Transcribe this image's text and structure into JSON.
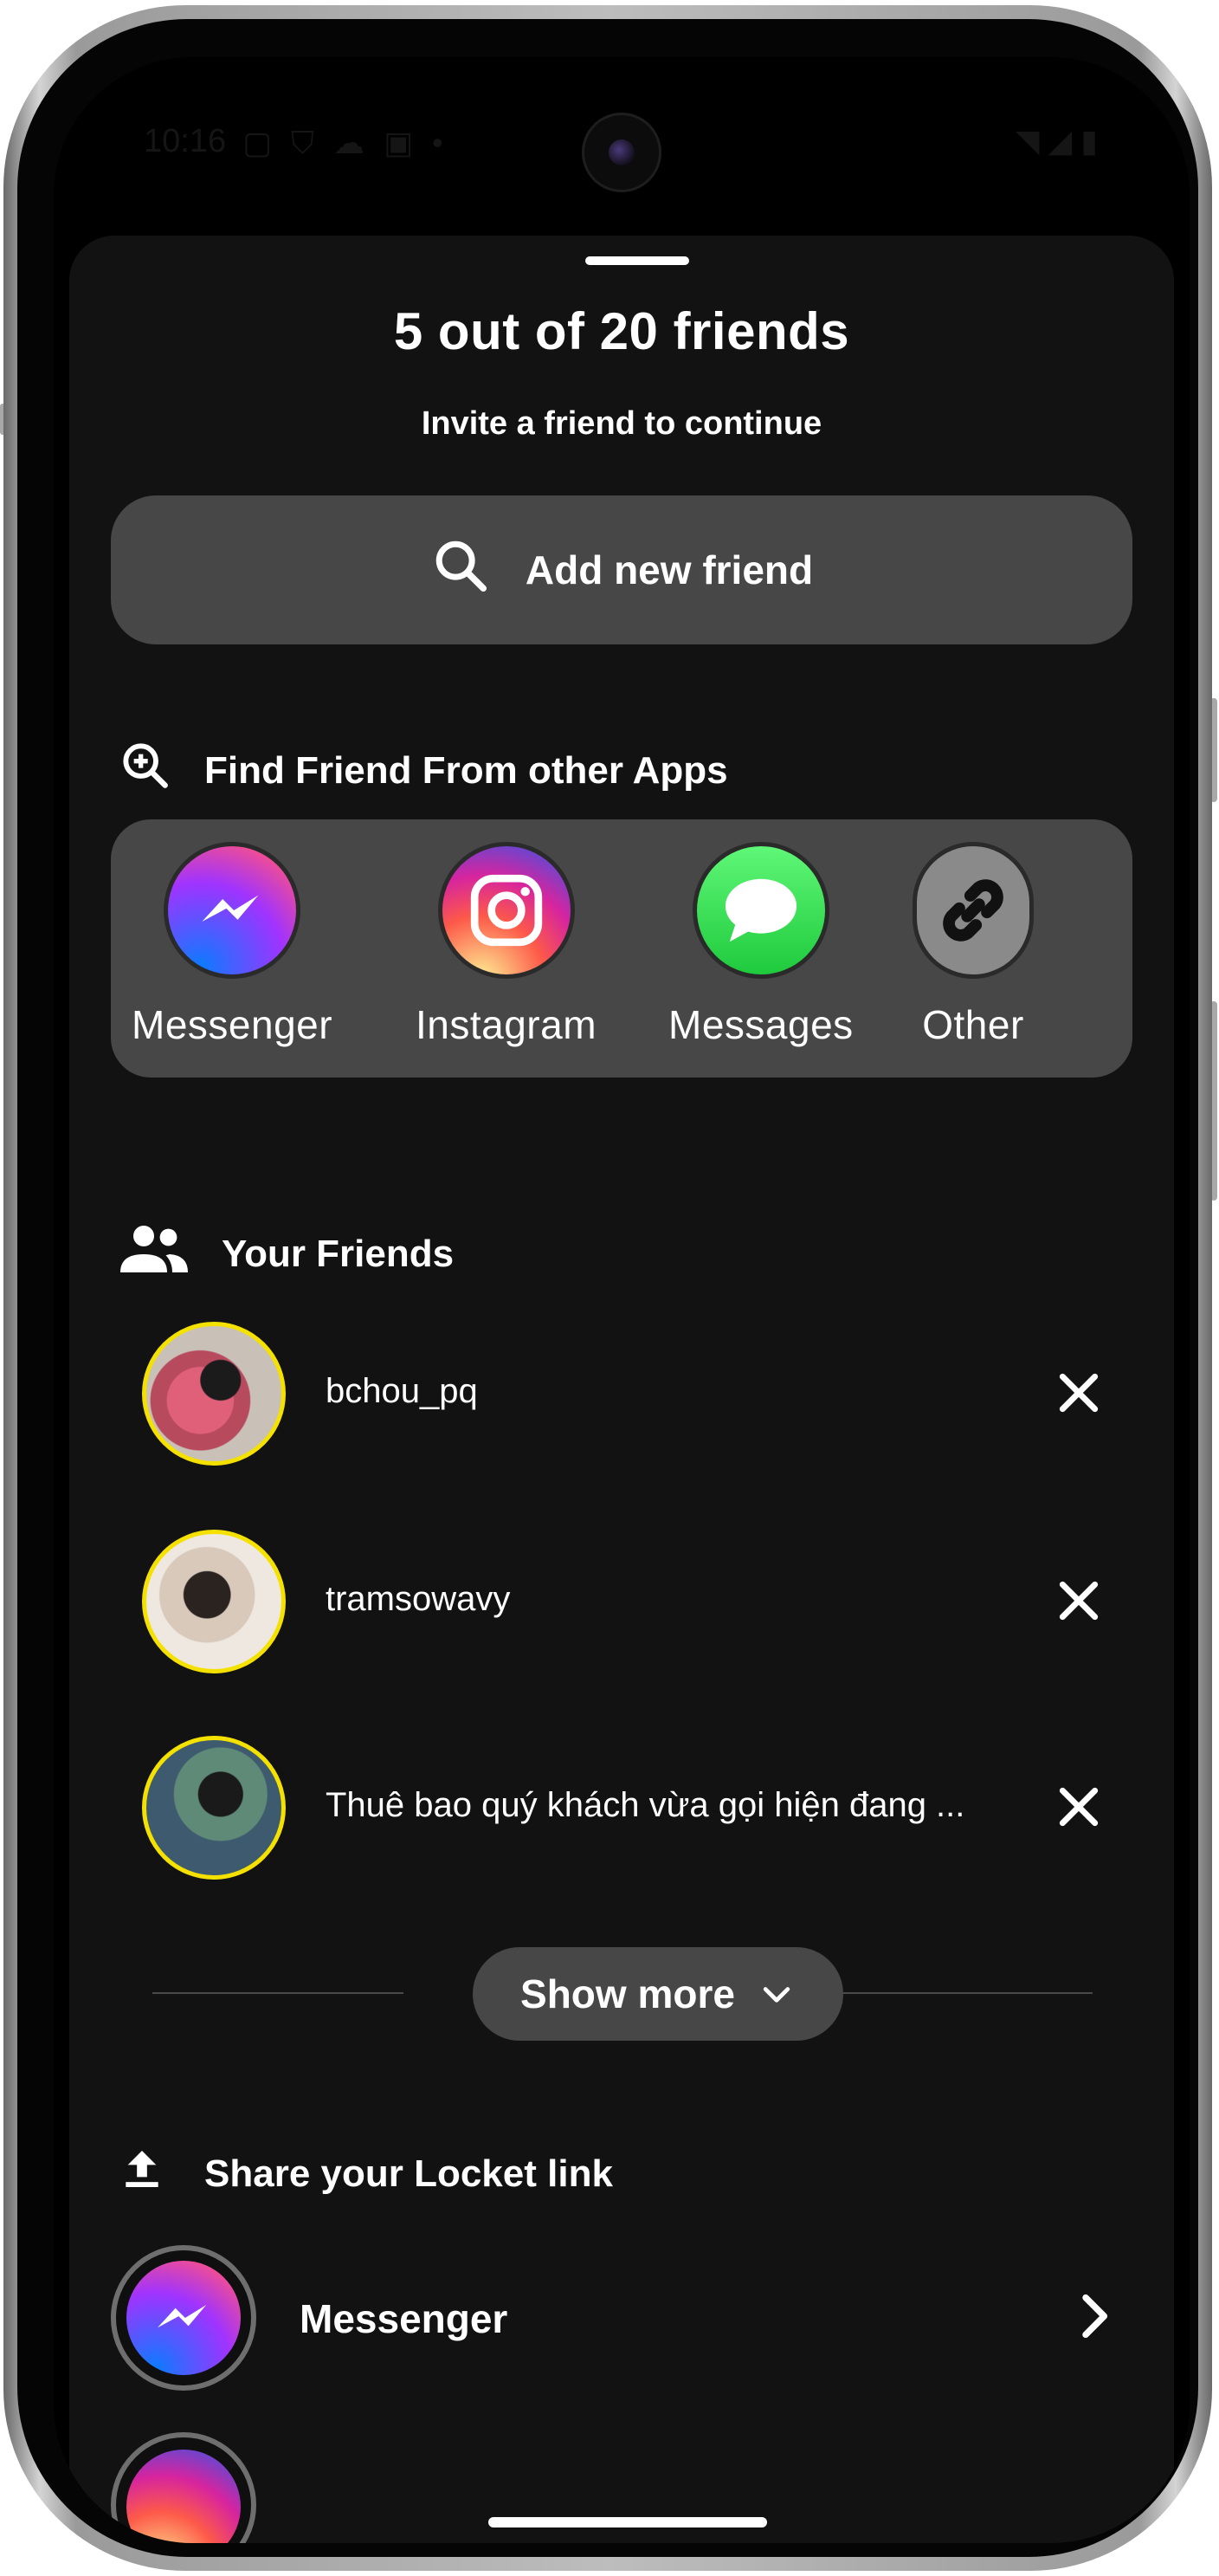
{
  "status_bar": {
    "time": "10:16",
    "left_icons": [
      "notification-icon",
      "shield-icon",
      "cloud-icon",
      "sim-icon",
      "dot-icon"
    ],
    "right_icons": [
      "wifi-icon",
      "signal-icon",
      "battery-icon"
    ]
  },
  "sheet": {
    "title": "5 out of 20 friends",
    "subtitle": "Invite a friend to continue",
    "add_friend_button": {
      "label": "Add new friend",
      "icon": "search-icon"
    }
  },
  "find_section": {
    "heading": "Find Friend From other Apps",
    "icon": "zoom-in-icon",
    "apps": [
      {
        "label": "Messenger",
        "icon": "messenger-icon"
      },
      {
        "label": "Instagram",
        "icon": "instagram-icon"
      },
      {
        "label": "Messages",
        "icon": "messages-icon"
      },
      {
        "label": "Other",
        "icon": "link-icon"
      }
    ]
  },
  "friends_section": {
    "heading": "Your Friends",
    "icon": "people-icon",
    "friends": [
      {
        "name": "bchou_pq"
      },
      {
        "name": "tramsowavy"
      },
      {
        "name": "Thuê bao quý khách vừa gọi hiện đang ..."
      }
    ],
    "show_more_label": "Show more"
  },
  "share_section": {
    "heading": "Share your Locket link",
    "icon": "upload-icon",
    "items": [
      {
        "label": "Messenger",
        "icon": "messenger-icon"
      }
    ]
  },
  "colors": {
    "sheet_bg": "#121212",
    "button_bg": "#474747",
    "avatar_ring": "#f5e100",
    "text": "#ffffff"
  }
}
